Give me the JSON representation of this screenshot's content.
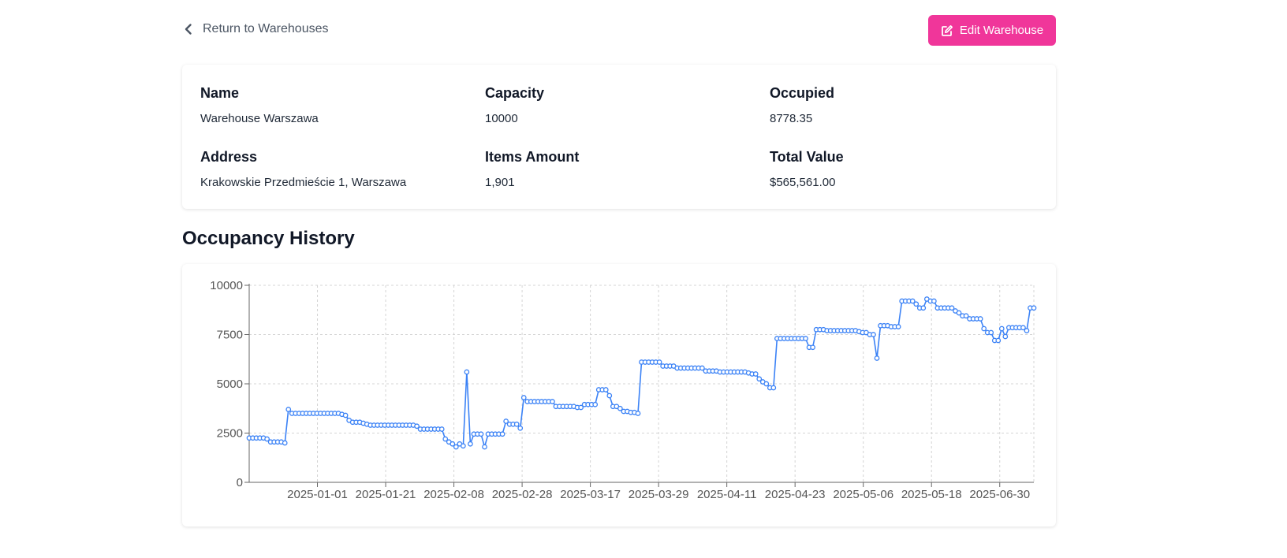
{
  "nav": {
    "back_label": "Return to Warehouses",
    "edit_label": "Edit Warehouse"
  },
  "details": {
    "name_label": "Name",
    "name_value": "Warehouse Warszawa",
    "capacity_label": "Capacity",
    "capacity_value": "10000",
    "occupied_label": "Occupied",
    "occupied_value": "8778.35",
    "address_label": "Address",
    "address_value": "Krakowskie Przedmieście 1, Warszawa",
    "items_label": "Items Amount",
    "items_value": "1,901",
    "value_label": "Total Value",
    "value_value": "$565,561.00"
  },
  "history": {
    "title": "Occupancy History"
  },
  "colors": {
    "accent": "#f0369a",
    "series": "#3b82f6"
  },
  "chart_data": {
    "type": "line",
    "title": "",
    "xlabel": "",
    "ylabel": "",
    "ylim": [
      0,
      10000
    ],
    "yticks": [
      0,
      2500,
      5000,
      7500,
      10000
    ],
    "xticks": [
      "2025-01-01",
      "2025-01-21",
      "2025-02-08",
      "2025-02-28",
      "2025-03-17",
      "2025-03-29",
      "2025-04-11",
      "2025-04-23",
      "2025-05-06",
      "2025-05-18",
      "2025-06-30"
    ],
    "grid": true,
    "series": [
      {
        "values": [
          2250,
          2250,
          2250,
          2250,
          2250,
          2200,
          2050,
          2050,
          2050,
          2050,
          2000,
          3700,
          3500,
          3500,
          3500,
          3500,
          3500,
          3500,
          3500,
          3500,
          3500,
          3500,
          3500,
          3500,
          3500,
          3500,
          3450,
          3400,
          3150,
          3050,
          3050,
          3050,
          3000,
          2950,
          2900,
          2900,
          2900,
          2900,
          2900,
          2900,
          2900,
          2900,
          2900,
          2900,
          2900,
          2900,
          2900,
          2850,
          2700,
          2700,
          2700,
          2700,
          2700,
          2700,
          2700,
          2200,
          2050,
          1950,
          1800,
          1950,
          1850,
          5600,
          1950,
          2450,
          2450,
          2450,
          1800,
          2450,
          2450,
          2450,
          2450,
          2450,
          3100,
          2950,
          2950,
          2950,
          2750,
          4300,
          4100,
          4100,
          4100,
          4100,
          4100,
          4100,
          4100,
          4100,
          3850,
          3850,
          3850,
          3850,
          3850,
          3850,
          3800,
          3800,
          3950,
          3950,
          3950,
          3950,
          4700,
          4700,
          4700,
          4400,
          3850,
          3850,
          3750,
          3600,
          3600,
          3550,
          3550,
          3500,
          6100,
          6100,
          6100,
          6100,
          6100,
          6100,
          5900,
          5900,
          5900,
          5900,
          5800,
          5800,
          5800,
          5800,
          5800,
          5800,
          5800,
          5800,
          5650,
          5650,
          5650,
          5650,
          5600,
          5600,
          5600,
          5600,
          5600,
          5600,
          5600,
          5600,
          5550,
          5500,
          5500,
          5250,
          5100,
          5000,
          4800,
          4800,
          7300,
          7300,
          7300,
          7300,
          7300,
          7300,
          7300,
          7300,
          7300,
          6850,
          6850,
          7750,
          7750,
          7750,
          7700,
          7700,
          7700,
          7700,
          7700,
          7700,
          7700,
          7700,
          7700,
          7650,
          7600,
          7600,
          7500,
          7500,
          6300,
          7950,
          7950,
          7950,
          7900,
          7900,
          7900,
          9200,
          9200,
          9200,
          9200,
          9050,
          8850,
          8850,
          9300,
          9200,
          9200,
          8850,
          8850,
          8850,
          8850,
          8850,
          8700,
          8600,
          8450,
          8450,
          8300,
          8300,
          8300,
          8300,
          7800,
          7600,
          7600,
          7200,
          7200,
          7800,
          7400,
          7850,
          7850,
          7850,
          7850,
          7850,
          7700,
          8850,
          8850
        ]
      }
    ]
  }
}
